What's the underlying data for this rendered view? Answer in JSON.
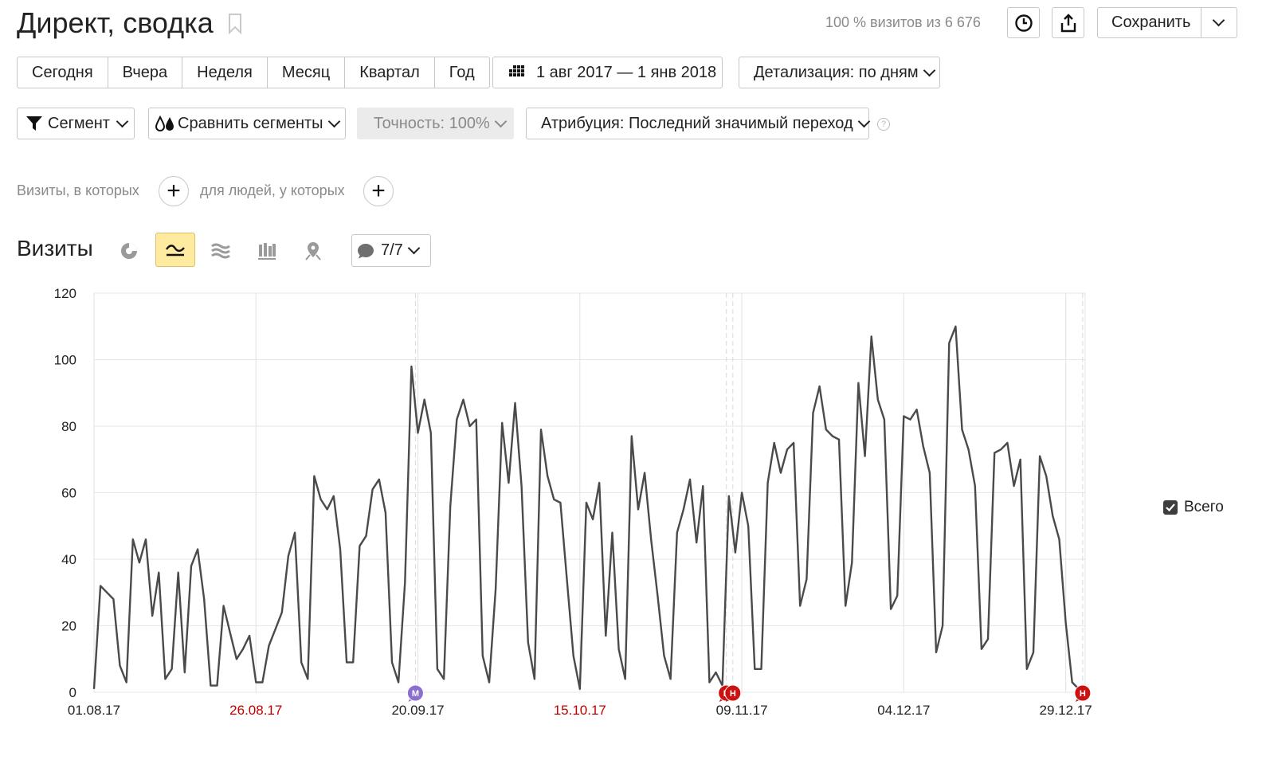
{
  "header": {
    "title": "Директ, сводка",
    "visits_info": "100 % визитов из 6 676",
    "save_label": "Сохранить"
  },
  "periods": [
    "Сегодня",
    "Вчера",
    "Неделя",
    "Месяц",
    "Квартал",
    "Год"
  ],
  "date_range": "1 авг 2017 — 1 янв 2018",
  "detail": "Детализация: по дням",
  "filters": {
    "segment": "Сегмент",
    "compare": "Сравнить сегменты",
    "accuracy": "Точность: 100%",
    "attribution": "Атрибуция: Последний значимый переход"
  },
  "conditions": {
    "visits_label": "Визиты, в которых",
    "people_label": "для людей, у которых"
  },
  "chart_section": {
    "title": "Визиты",
    "notes_count": "7/7",
    "legend_label": "Всего"
  },
  "colors": {
    "line": "#4a4a4a",
    "weekend": "#c00000",
    "accent": "#ffeba0",
    "marker_m": "#8b6fcf",
    "marker_h": "#cc1111"
  },
  "chart_data": {
    "type": "line",
    "x_ticks": [
      {
        "label": "01.08.17",
        "weekend": false
      },
      {
        "label": "26.08.17",
        "weekend": true
      },
      {
        "label": "20.09.17",
        "weekend": false
      },
      {
        "label": "15.10.17",
        "weekend": true
      },
      {
        "label": "09.11.17",
        "weekend": false
      },
      {
        "label": "04.12.17",
        "weekend": false
      },
      {
        "label": "29.12.17",
        "weekend": false
      }
    ],
    "y_ticks": [
      "0",
      "20",
      "40",
      "60",
      "80",
      "100",
      "120"
    ],
    "ylim": [
      0,
      120
    ],
    "x_range": [
      "2017-08-01",
      "2018-01-01"
    ],
    "grid": true,
    "series": [
      {
        "name": "Всего",
        "values": [
          1,
          32,
          30,
          28,
          8,
          3,
          46,
          39,
          46,
          23,
          36,
          4,
          7,
          36,
          6,
          38,
          43,
          28,
          2,
          2,
          26,
          18,
          10,
          13,
          17,
          3,
          3,
          14,
          19,
          24,
          41,
          48,
          9,
          4,
          65,
          58,
          55,
          59,
          43,
          9,
          9,
          44,
          47,
          61,
          64,
          54,
          9,
          3,
          33,
          98,
          78,
          88,
          78,
          7,
          4,
          56,
          82,
          88,
          80,
          82,
          11,
          3,
          31,
          81,
          63,
          87,
          62,
          15,
          4,
          79,
          65,
          58,
          57,
          34,
          11,
          1,
          57,
          52,
          63,
          17,
          48,
          13,
          4,
          77,
          55,
          66,
          46,
          29,
          11,
          4,
          48,
          55,
          64,
          45,
          62,
          3,
          6,
          2,
          59,
          42,
          60,
          50,
          7,
          7,
          63,
          75,
          66,
          73,
          75,
          26,
          34,
          84,
          92,
          79,
          77,
          76,
          26,
          39,
          93,
          71,
          107,
          88,
          82,
          25,
          29,
          83,
          82,
          85,
          74,
          66,
          12,
          20,
          105,
          110,
          79,
          73,
          62,
          13,
          16,
          72,
          73,
          75,
          62,
          70,
          7,
          12,
          71,
          65,
          53,
          46,
          21,
          3,
          1
        ]
      }
    ],
    "annotations": [
      {
        "label": "М",
        "date": "2017-09-19",
        "type": "M"
      },
      {
        "label": "Н",
        "date": "2017-11-06",
        "type": "H"
      },
      {
        "label": "Н",
        "date": "2017-11-07",
        "type": "H"
      },
      {
        "label": "Н",
        "date": "2017-12-31",
        "type": "H"
      }
    ]
  }
}
